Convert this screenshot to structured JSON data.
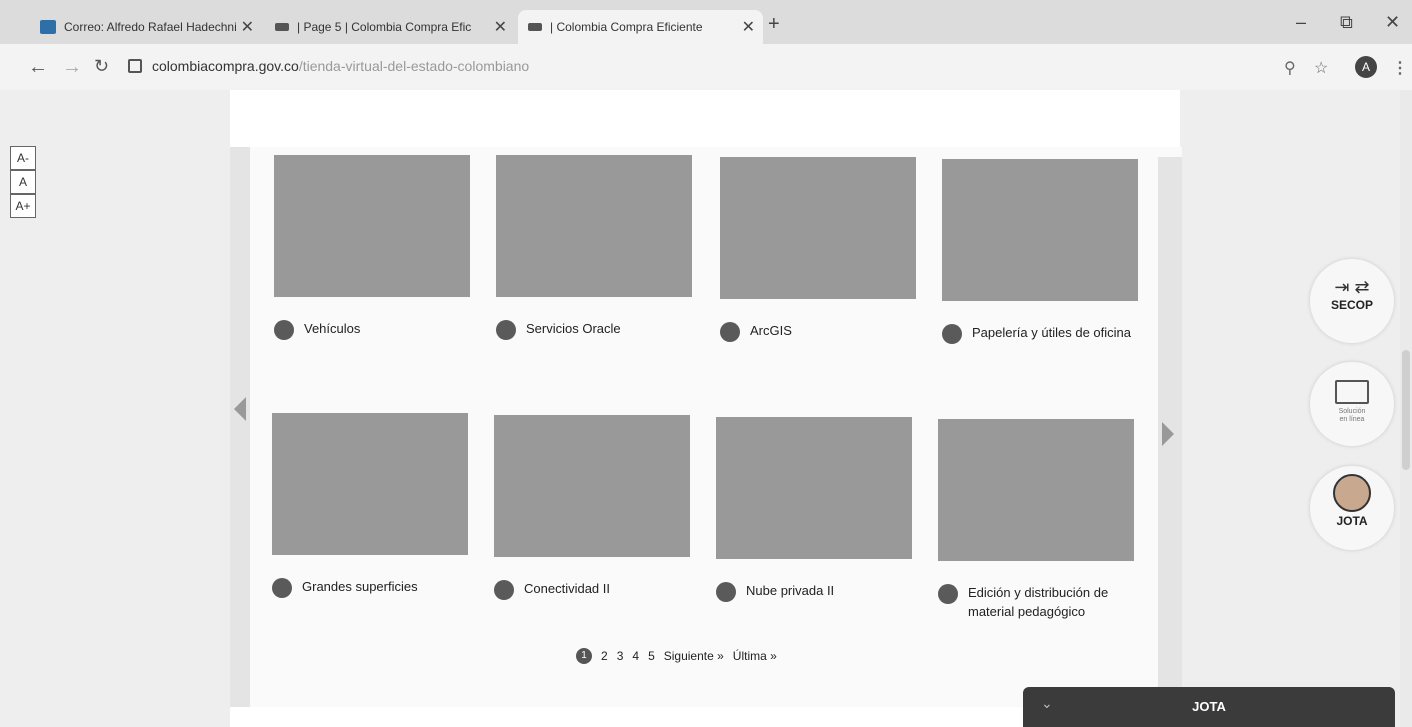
{
  "browser": {
    "tabs": [
      {
        "title": "Correo: Alfredo Rafael Hadechni",
        "close": "✕"
      },
      {
        "title": "| Page 5 | Colombia Compra Efic",
        "close": "✕"
      },
      {
        "title": "| Colombia Compra Eficiente",
        "close": "✕"
      }
    ],
    "new_tab": "+",
    "window": {
      "minimize": "–",
      "maximize": "⧉",
      "close": "✕"
    },
    "url_domain": "colombiacompra.gov.co",
    "url_path": "/tienda-virtual-del-estado-colombiano",
    "profile_initial": "A",
    "icons": [
      "back-icon",
      "forward-icon",
      "reload-icon",
      "zoom-icon",
      "star-icon",
      "menu-icon"
    ]
  },
  "font_sizer": [
    "A-",
    "A",
    "A+"
  ],
  "catalog": [
    {
      "label": "Vehículos",
      "icon": "car-icon"
    },
    {
      "label": "Servicios Oracle",
      "icon": "oracle-icon"
    },
    {
      "label": "ArcGIS",
      "icon": "globe-icon"
    },
    {
      "label": "Papelería y útiles de oficina",
      "icon": "paper-icon"
    },
    {
      "label": "Grandes superficies",
      "icon": "cart-icon"
    },
    {
      "label": "Conectividad II",
      "icon": "network-icon"
    },
    {
      "label": "Nube privada II",
      "icon": "cloud-icon"
    },
    {
      "label": "Edición y distribución de material pedagógico",
      "icon": "book-icon"
    }
  ],
  "pager": {
    "current": "1",
    "pages": [
      "2",
      "3",
      "4",
      "5"
    ],
    "next": "Siguiente »",
    "last": "Última »"
  },
  "fabs": {
    "secop": "SECOP",
    "online_line1": "Solución",
    "online_line2": "en línea",
    "jota": "JOTA"
  },
  "chat": {
    "title": "JOTA",
    "chevron": "⌄"
  }
}
